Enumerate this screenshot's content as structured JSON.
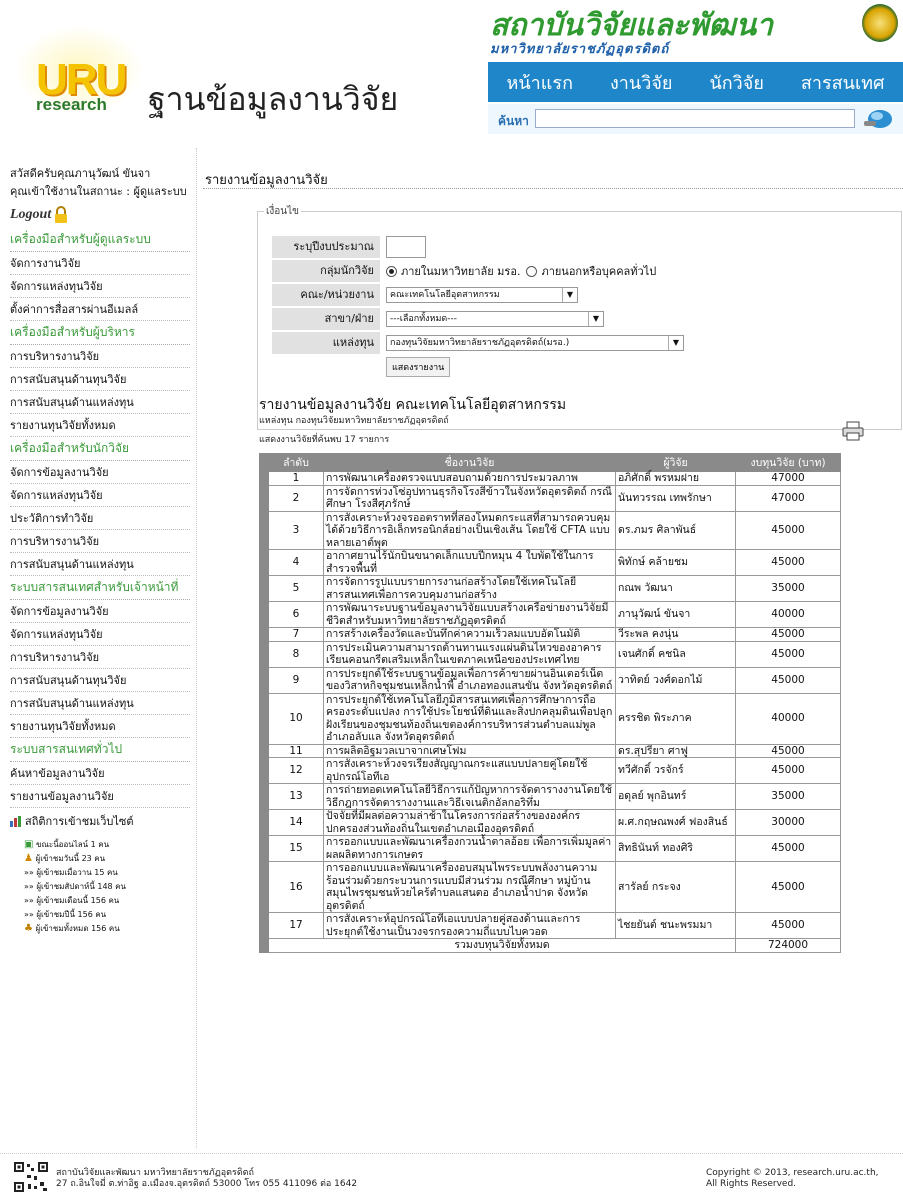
{
  "header": {
    "logo_uru": "URU",
    "logo_research": "research",
    "site_title": "ฐานข้อมูลงานวิจัย",
    "inst_name": "สถาบันวิจัยและพัฒนา",
    "inst_sub": "มหาวิทยาลัยราชภัฏอุตรดิตถ์",
    "nav": [
      "หน้าแรก",
      "งานวิจัย",
      "นักวิจัย",
      "สารสนเทศ"
    ],
    "search_label": "ค้นหา",
    "search_value": ""
  },
  "sidebar": {
    "greeting": "สวัสดีครับคุณภานุวัฒน์ ขันจา",
    "status": "คุณเข้าใช้งานในสถานะ : ผู้ดูแลระบบ",
    "logout": "Logout",
    "sections": [
      {
        "title": "เครื่องมือสำหรับผู้ดูแลระบบ",
        "items": [
          "จัดการงานวิจัย",
          "จัดการแหล่งทุนวิจัย",
          "ตั้งค่าการสื่อสารผ่านอีเมลล์"
        ]
      },
      {
        "title": "เครื่องมือสำหรับผู้บริหาร",
        "items": [
          "การบริหารงานวิจัย",
          "การสนับสนุนด้านทุนวิจัย",
          "การสนับสนุนด้านแหล่งทุน",
          "รายงานทุนวิจัยทั้งหมด"
        ]
      },
      {
        "title": "เครื่องมือสำหรับนักวิจัย",
        "items": [
          "จัดการข้อมูลงานวิจัย",
          "จัดการแหล่งทุนวิจัย",
          "ประวัติการทำวิจัย",
          "การบริหารงานวิจัย",
          "การสนับสนุนด้านแหล่งทุน"
        ]
      },
      {
        "title": "ระบบสารสนเทศสำหรับเจ้าหน้าที่",
        "items": [
          "จัดการข้อมูลงานวิจัย",
          "จัดการแหล่งทุนวิจัย",
          "การบริหารงานวิจัย",
          "การสนับสนุนด้านทุนวิจัย",
          "การสนับสนุนด้านแหล่งทุน",
          "รายงานทุนวิจัยทั้งหมด"
        ]
      },
      {
        "title": "ระบบสารสนเทศทั่วไป",
        "items": [
          "ค้นหาข้อมูลงานวิจัย",
          "รายงานข้อมูลงานวิจัย"
        ]
      }
    ],
    "stats_title": "สถิติการเข้าชมเว็บไซต์",
    "stats": [
      "ขณะนี้ออนไลน์ 1 คน",
      "ผู้เข้าชมวันนี้ 23 คน",
      "»» ผู้เข้าชมเมื่อวาน 15 คน",
      "»» ผู้เข้าชมสัปดาห์นี้ 148 คน",
      "»» ผู้เข้าชมเดือนนี้ 156 คน",
      "»» ผู้เข้าชมปีนี้ 156 คน",
      "ผู้เข้าชมทั้งหมด 156 คน"
    ]
  },
  "main": {
    "page_title": "รายงานข้อมูลงานวิจัย",
    "cond_legend": "เงื่อนไข",
    "labels": {
      "year": "ระบุปีงบประมาณ",
      "group": "กลุ่มนักวิจัย",
      "faculty": "คณะ/หน่วยงาน",
      "branch": "สาขา/ฝ่าย",
      "fund": "แหล่งทุน"
    },
    "year_value": "",
    "group_opt1": "ภายในมหาวิทยาลัย มรอ.",
    "group_opt2": "ภายนอกหรือบุคคลทั่วไป",
    "faculty_value": "คณะเทคโนโลยีอุตสาหกรรม",
    "branch_value": "---เลือกทั้งหมด---",
    "fund_value": "กองทุนวิจัยมหาวิทยาลัยราชภัฏอุตรดิตถ์(มรอ.)",
    "show_button": "แสดงรายงาน",
    "report_title": "รายงานข้อมูลงานวิจัย คณะเทคโนโลยีอุตสาหกรรม",
    "report_sub": "แหล่งทุน กองทุนวิจัยมหาวิทยาลัยราชภัฏอุตรดิตถ์",
    "report_count": "แสดงงานวิจัยที่ค้นพบ 17 รายการ",
    "columns": [
      "ลำดับ",
      "ชื่องานวิจัย",
      "ผู้วิจัย",
      "งบทุนวิจัย (บาท)"
    ],
    "rows": [
      {
        "no": "1",
        "name": "การพัฒนาเครื่องตรวจแบบสอบถามด้วยการประมวลภาพ",
        "res": "อภิศักดิ์ พรหมฝาย",
        "bud": "47000"
      },
      {
        "no": "2",
        "name": "การจัดการห่วงโซ่อุปทานธุรกิจโรงสีข้าวในจังหวัดอุตรดิตถ์ กรณีศึกษา โรงสีศุภรักษ์",
        "res": "นันทวรรณ เทพรักษา",
        "bud": "47000"
      },
      {
        "no": "3",
        "name": "การสังเคราะห์วงจรออตราทที่สองโหมดกระแสที่สามารถควบคุมได้ด้วยวิธีการอิเล็กทรอนิกส์อย่างเป็นเชิงเส้น โดยใช้ CFTA แบบหลายเอาต์พุต",
        "res": "ดร.ภมร ศิลาพันธ์",
        "bud": "45000"
      },
      {
        "no": "4",
        "name": "อากาศยานไร้นักบินขนาดเล็กแบบปีกหมุน 4 ใบพัดใช้ในการสำรวจพื้นที่",
        "res": "พิทักษ์ คล้ายชม",
        "bud": "45000"
      },
      {
        "no": "5",
        "name": "การจัดการรูปแบบรายการงานก่อสร้างโดยใช้เทคโนโลยีสารสนเทศเพื่อการควบคุมงานก่อสร้าง",
        "res": "กณพ วัฒนา",
        "bud": "35000"
      },
      {
        "no": "6",
        "name": "การพัฒนาระบบฐานข้อมูลงานวิจัยแบบสร้างเครือข่ายงานวิจัยมีชีวิตสำหรับมหาวิทยาลัยราชภัฏอุตรดิตถ์",
        "res": "ภานุวัฒน์ ขันจา",
        "bud": "40000"
      },
      {
        "no": "7",
        "name": "การสร้างเครื่องวัดและบันทึกค่าความเร็วลมแบบอัตโนมัติ",
        "res": "วีระพล คงนุ่น",
        "bud": "45000"
      },
      {
        "no": "8",
        "name": "การประเมินความสามารถต้านทานแรงแผ่นดินไหวของอาคารเรียนคอนกรีตเสริมเหล็กในเขตภาคเหนือของประเทศไทย",
        "res": "เจนศักดิ์ คชนิล",
        "bud": "45000"
      },
      {
        "no": "9",
        "name": "การประยุกต์ใช้ระบบฐานข้อมูลเพื่อการค้าขายผ่านอินเตอร์เน็ตของวิสาหกิจชุมชนเหล็กน้ำพี้ อำเภอทองแสนขัน จังหวัดอุตรดิตถ์",
        "res": "วาทิตย์ วงศ์ดอกไม้",
        "bud": "45000"
      },
      {
        "no": "10",
        "name": "การประยุกต์ใช้เทคโนโลยีภูมิสารสนเทศเพื่อการศึกษาการถือครองระดับแปลง การใช้ประโยชน์ที่ดินและสิ่งปกคลุมดินเพื่อปลูกฝังเรียนของชุมชนท้องถิ่นเขตองค์การบริหารส่วนตำบลแม่พูลอำเภอลับแล จังหวัดอุตรดิตถ์",
        "res": "ครรชิต พิระภาค",
        "bud": "40000"
      },
      {
        "no": "11",
        "name": "การผลิตอิฐมวลเบาจากเศษโฟม",
        "res": "ดร.สุปรียา ศาฟู",
        "bud": "45000"
      },
      {
        "no": "12",
        "name": "การสังเคราะห์วงจรเรียงสัญญาณกระแสแบบปลายคู่โดยใช้อุปกรณ์โอทีเอ",
        "res": "ทวีศักดิ์ วรจักร์",
        "bud": "45000"
      },
      {
        "no": "13",
        "name": "การถ่ายทอดเทคโนโลยีวิธีการแก้ปัญหาการจัดตารางงานโดยใช้วิธีกฎการจัดตารางงานและวิธีเจเนติกอัลกอริทึ่ม",
        "res": "อดุลย์ พุกอินทร์",
        "bud": "35000"
      },
      {
        "no": "14",
        "name": "ปัจจัยที่มีผลต่อความล่าช้าในโครงการก่อสร้างขององค์กรปกครองส่วนท้องถิ่นในเขตอำเภอเมืองอุตรดิตถ์",
        "res": "ผ.ศ.กฤษณพงศ์ ฟองสินธ์",
        "bud": "30000"
      },
      {
        "no": "15",
        "name": "การออกแบบและพัฒนาเครื่องกวนน้ำตาลอ้อย เพื่อการเพิ่มมูลค่าผลผลิตทางการเกษตร",
        "res": "สิทธินันท์ ทองศิริ",
        "bud": "45000"
      },
      {
        "no": "16",
        "name": "การออกแบบและพัฒนาเครื่องอบสมุนไพรระบบพลังงานความร้อนร่วมด้วยกระบวนการแบบมีส่วนร่วม กรณีศึกษา หมู่บ้านสมุนไพรชุมชนห้วยไคร้ตำบลแสนตอ อำเภอน้ำปาด จังหวัดอุตรดิตถ์",
        "res": "สารัลย์ กระจง",
        "bud": "45000"
      },
      {
        "no": "17",
        "name": "การสังเคราะห์อุปกรณ์โอทีเอแบบปลายคู่สองด้านและการประยุกต์ใช้งานเป็นวงจรกรองความถี่แบบไบควอด",
        "res": "ไชยยันต์ ชนะพรมมา",
        "bud": "45000"
      }
    ],
    "total_label": "รวมงบทุนวิจัยทั้งหมด",
    "total_value": "724000"
  },
  "footer": {
    "addr1": "สถาบันวิจัยและพัฒนา มหาวิทยาลัยราชภัฏอุตรดิตถ์",
    "addr2": "27 ถ.อินใจมี่ ต.ท่าอิฐ อ.เมืองจ.อุตรดิตถ์ 53000 โทร 055 411096 ต่อ 1642",
    "copy1": "Copyright © 2013, research.uru.ac.th,",
    "copy2": "All Rights Reserved."
  },
  "colors": {
    "nav_bg": "#1f87c9",
    "sidebar_section": "#3a9a3a",
    "table_header": "#8a8a8a"
  }
}
